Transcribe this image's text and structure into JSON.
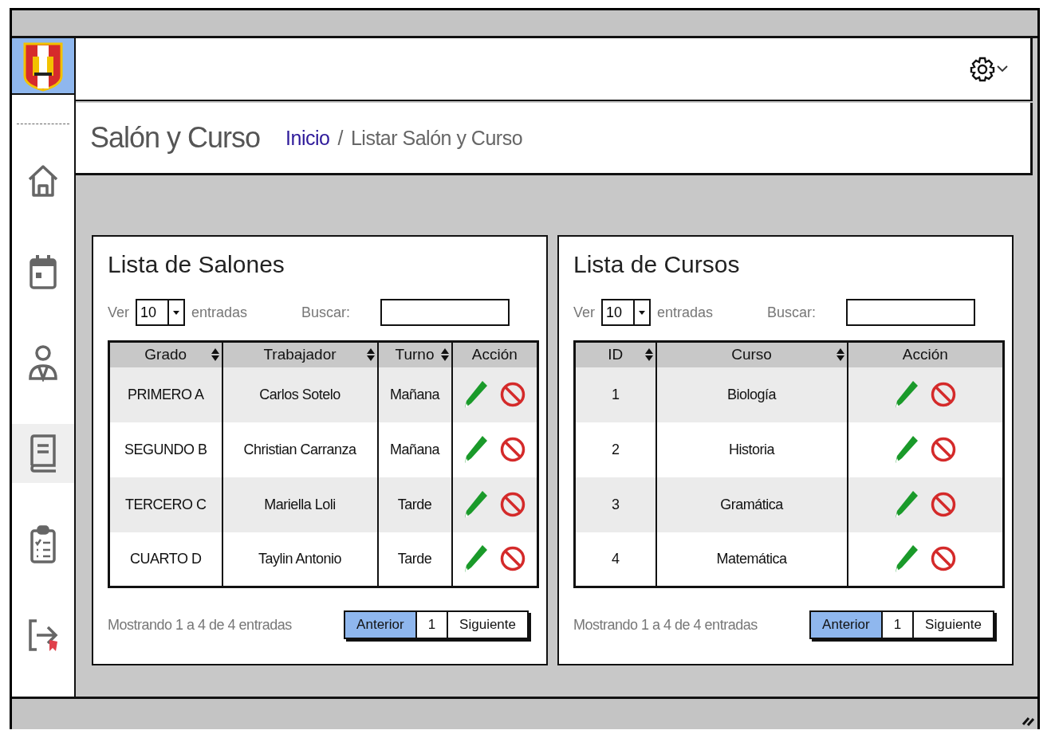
{
  "sidebar": {
    "items": [
      {
        "kind": "home",
        "selected": false
      },
      {
        "kind": "calendar",
        "selected": false
      },
      {
        "kind": "user",
        "selected": false
      },
      {
        "kind": "book",
        "selected": true
      },
      {
        "kind": "clipboard",
        "selected": false
      },
      {
        "kind": "logout",
        "selected": false
      }
    ]
  },
  "header": {
    "title": "Salón y Curso",
    "breadcrumb": [
      {
        "label": "Inicio",
        "link": true
      },
      {
        "label": "/",
        "link": false
      },
      {
        "label": "Listar Salón y Curso",
        "link": false
      }
    ]
  },
  "panels": [
    {
      "title": "Lista de Salones",
      "show_label": "Ver",
      "page_size": "10",
      "entries_label": "entradas",
      "search_label": "Buscar:",
      "columns": [
        {
          "label": "Grado",
          "kind": "text",
          "sortable": true
        },
        {
          "label": "Trabajador",
          "kind": "text",
          "sortable": true
        },
        {
          "label": "Turno",
          "kind": "text",
          "sortable": true
        },
        {
          "label": "Acción",
          "kind": "actions",
          "sortable": false
        }
      ],
      "rows": [
        [
          "PRIMERO A",
          "Carlos Sotelo",
          "Mañana"
        ],
        [
          "SEGUNDO B",
          "Christian Carranza",
          "Mañana"
        ],
        [
          "TERCERO C",
          "Mariella Loli",
          "Tarde"
        ],
        [
          "CUARTO D",
          "Taylin Antonio",
          "Tarde"
        ]
      ],
      "summary": "Mostrando 1 a 4 de 4 entradas",
      "pages": [
        {
          "label": "Anterior",
          "selected": true
        },
        {
          "label": "1",
          "selected": false
        },
        {
          "label": "Siguiente",
          "selected": false
        }
      ]
    },
    {
      "title": "Lista de Cursos",
      "show_label": "Ver",
      "page_size": "10",
      "entries_label": "entradas",
      "search_label": "Buscar:",
      "columns": [
        {
          "label": "ID",
          "kind": "text",
          "sortable": true
        },
        {
          "label": "Curso",
          "kind": "text",
          "sortable": true
        },
        {
          "label": "Acción",
          "kind": "actions",
          "sortable": false
        }
      ],
      "rows": [
        [
          "1",
          "Biología"
        ],
        [
          "2",
          "Historia"
        ],
        [
          "3",
          "Gramática"
        ],
        [
          "4",
          "Matemática"
        ]
      ],
      "summary": "Mostrando 1 a 4 de 4 entradas",
      "pages": [
        {
          "label": "Anterior",
          "selected": true
        },
        {
          "label": "1",
          "selected": false
        },
        {
          "label": "Siguiente",
          "selected": false
        }
      ]
    }
  ]
}
